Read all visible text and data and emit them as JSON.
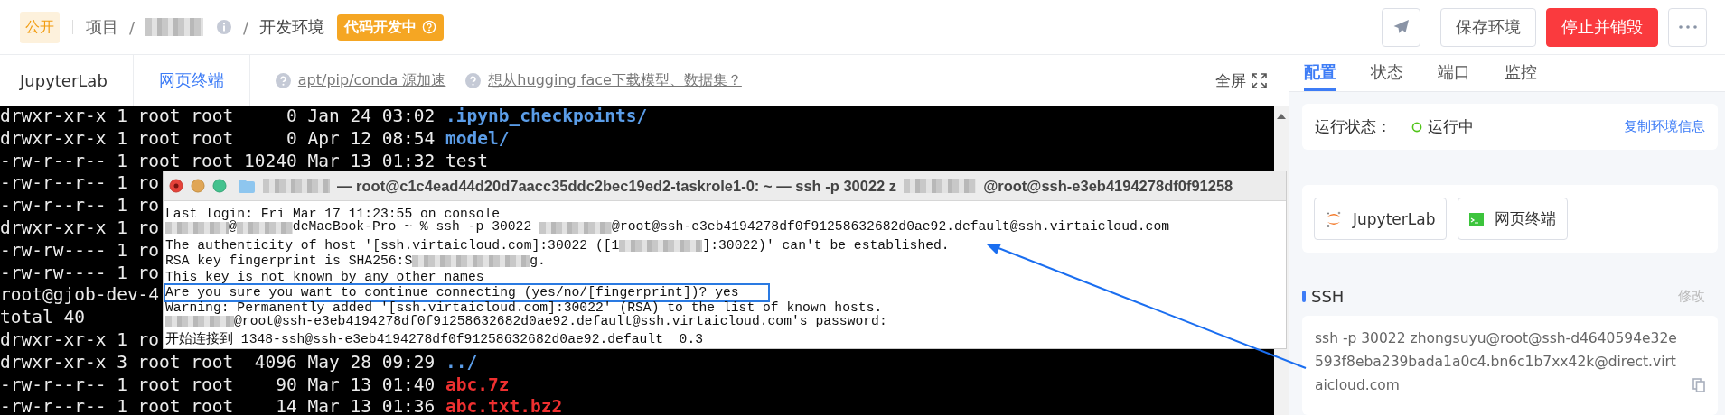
{
  "header": {
    "visibility_badge": "公开",
    "breadcrumb_root": "项目",
    "breadcrumb_separators": [
      "/",
      "/"
    ],
    "project_name_redacted": true,
    "current": "开发环境",
    "status_badge": "代码开发中",
    "actions": [
      {
        "kind": "send"
      },
      {
        "kind": "default",
        "label": "保存环境"
      },
      {
        "kind": "danger",
        "label": "停止并销毁"
      },
      {
        "kind": "more"
      }
    ]
  },
  "tabs": [
    {
      "label": "JupyterLab",
      "selected": false
    },
    {
      "label": "网页终端",
      "selected": true
    }
  ],
  "help_links": [
    "apt/pip/conda 源加速",
    "想从hugging face下载模型、数据集？"
  ],
  "fullscreen": "全屏",
  "terminal": {
    "lines": [
      [
        {
          "kind": "text",
          "text": "drwxr-xr-x 1 root root     0 Jan 24 03:02 "
        },
        {
          "kind": "dir",
          "text": ".ipynb_checkpoints/"
        }
      ],
      [
        {
          "kind": "text",
          "text": "drwxr-xr-x 1 root root     0 Apr 12 08:54 "
        },
        {
          "kind": "dir",
          "text": "model/"
        }
      ],
      [
        {
          "kind": "text",
          "text": "-rw-r--r-- 1 root root 10240 Mar 13 01:32 test"
        }
      ],
      [
        {
          "kind": "text",
          "text": "-rw-r--r-- 1 ro"
        }
      ],
      [
        {
          "kind": "text",
          "text": "-rw-r--r-- 1 ro"
        }
      ],
      [
        {
          "kind": "text",
          "text": "drwxr-xr-x 1 ro"
        }
      ],
      [
        {
          "kind": "text",
          "text": "-rw-rw---- 1 ro"
        }
      ],
      [
        {
          "kind": "text",
          "text": "-rw-rw---- 1 ro"
        }
      ],
      [
        {
          "kind": "text",
          "text": "root@gjob-dev-4"
        }
      ],
      [
        {
          "kind": "text",
          "text": "total 40"
        }
      ],
      [
        {
          "kind": "text",
          "text": "drwxr-xr-x 1 ro"
        }
      ],
      [
        {
          "kind": "text",
          "text": "drwxr-xr-x 3 root root  4096 May 28 09:29 "
        },
        {
          "kind": "dir",
          "text": "../"
        }
      ],
      [
        {
          "kind": "text",
          "text": "-rw-r--r-- 1 root root    90 Mar 13 01:40 "
        },
        {
          "kind": "archive",
          "text": "abc.7z"
        }
      ],
      [
        {
          "kind": "text",
          "text": "-rw-r--r-- 1 root root    14 Mar 13 01:36 "
        },
        {
          "kind": "archive",
          "text": "abc.txt.bz2"
        }
      ]
    ]
  },
  "ssh_window": {
    "title": [
      {
        "kind": "redacted"
      },
      {
        "kind": "text",
        "text": " — root@c1c4ead44d20d7aacc35ddc2bec19ed2-taskrole1-0: ~ — ssh -p 30022 z"
      },
      {
        "kind": "redacted"
      },
      {
        "kind": "text",
        "text": "@root@ssh-e3eb4194278df0f91258"
      }
    ],
    "lines": [
      {
        "boxed": false,
        "parts": [
          {
            "kind": "text",
            "text": "Last login: Fri Mar 17 11:23:55 on console"
          }
        ]
      },
      {
        "boxed": false,
        "parts": [
          {
            "kind": "redacted"
          },
          {
            "kind": "text",
            "text": "@"
          },
          {
            "kind": "redacted"
          },
          {
            "kind": "text",
            "text": "deMacBook-Pro ~ % ssh -p 30022 "
          },
          {
            "kind": "redacted"
          },
          {
            "kind": "text",
            "text": "@root@ssh-e3eb4194278df0f91258632682d0ae92.default@ssh.virtaicloud.com"
          }
        ]
      },
      {
        "boxed": false,
        "parts": [
          {
            "kind": "text",
            "text": "The authenticity of host '[ssh.virtaicloud.com]:30022 ([1"
          },
          {
            "kind": "redacted"
          },
          {
            "kind": "text",
            "text": "]:30022)' can't be established."
          }
        ]
      },
      {
        "boxed": false,
        "parts": [
          {
            "kind": "text",
            "text": "RSA key fingerprint is SHA256:S"
          },
          {
            "kind": "redacted"
          },
          {
            "kind": "text",
            "text": "g."
          }
        ]
      },
      {
        "boxed": false,
        "parts": [
          {
            "kind": "text",
            "text": "This key is not known by any other names"
          }
        ]
      },
      {
        "boxed": true,
        "parts": [
          {
            "kind": "text",
            "text": "Are you sure you want to continue connecting (yes/no/[fingerprint])? yes"
          }
        ]
      },
      {
        "boxed": false,
        "parts": [
          {
            "kind": "text",
            "text": "Warning: Permanently added '[ssh.virtaicloud.com]:30022' (RSA) to the list of known hosts."
          }
        ]
      },
      {
        "boxed": false,
        "parts": [
          {
            "kind": "redacted"
          },
          {
            "kind": "text",
            "text": "@root@ssh-e3eb4194278df0f91258632682d0ae92.default@ssh.virtaicloud.com's password:"
          }
        ]
      },
      {
        "boxed": false,
        "parts": [
          {
            "kind": "text",
            "text": "开始连接到 1348-ssh@ssh-e3eb4194278df0f91258632682d0ae92.default  0.3"
          }
        ]
      }
    ]
  },
  "side_tabs": [
    {
      "label": "配置",
      "selected": true
    },
    {
      "label": "状态",
      "selected": false
    },
    {
      "label": "端口",
      "selected": false
    },
    {
      "label": "监控",
      "selected": false
    }
  ],
  "status": {
    "label": "运行状态：",
    "value": "运行中",
    "running": true,
    "copy_link": "复制环境信息"
  },
  "quick_open": [
    {
      "kind": "jupyter",
      "label": "JupyterLab"
    },
    {
      "kind": "terminal",
      "label": "网页终端"
    }
  ],
  "ssh": {
    "title": "SSH",
    "edit": "修改",
    "command": "ssh -p 30022 zhongsuyu@root@ssh-d4640594e32e593f8eba239bada1a0c4.bn6c1b7xx42k@direct.virtaicloud.com",
    "arrow_annotation": true
  }
}
